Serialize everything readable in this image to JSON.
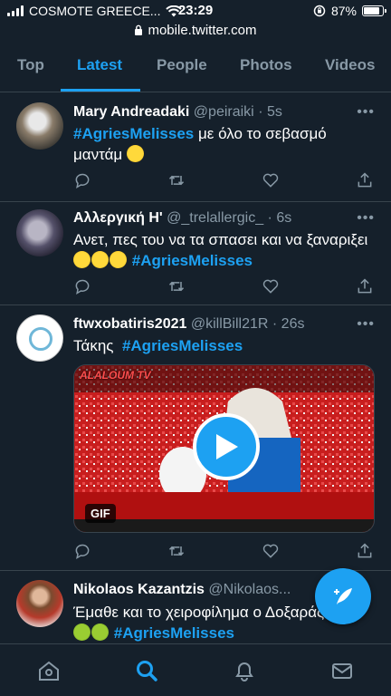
{
  "status_bar": {
    "carrier": "COSMOTE GREECE...",
    "time": "23:29",
    "battery": "87%",
    "battery_level": 0.87
  },
  "browser": {
    "url": "mobile.twitter.com"
  },
  "tabs": [
    {
      "label": "Top",
      "active": false
    },
    {
      "label": "Latest",
      "active": true
    },
    {
      "label": "People",
      "active": false
    },
    {
      "label": "Photos",
      "active": false
    },
    {
      "label": "Videos",
      "active": false
    }
  ],
  "tweets": [
    {
      "name": "Mary Andreadaki",
      "handle": "@peiraiki",
      "time": "5s",
      "hashtag": "#AgriesMelisses",
      "text": "με όλο το σεβασμό",
      "text2": "μαντάμ"
    },
    {
      "name": "Αλλεργική Η'",
      "handle": "@_trelallergic_",
      "time": "6s",
      "text": "Ανετ, πες του να τα σπασει και να ξαναριξει",
      "hashtag": "#AgriesMelisses"
    },
    {
      "name": "ftwxobatiris2021",
      "handle": "@killBill21R",
      "time": "26s",
      "text": "Τάκης",
      "hashtag": "#AgriesMelisses",
      "media": {
        "badge": "GIF",
        "watermark": "ALALOUM TV"
      }
    },
    {
      "name": "Nikolaos Kazantzis",
      "handle": "@Nikolaos...",
      "time": "",
      "text": "Έμαθε και το χειροφίλημα ο Δοξαράς",
      "hashtag": "#AgriesMelisses"
    }
  ],
  "icons": [
    "wifi-icon",
    "lock-icon",
    "reply-icon",
    "retweet-icon",
    "like-icon",
    "share-icon",
    "home-icon",
    "search-icon",
    "bell-icon",
    "mail-icon",
    "compose-icon",
    "play-icon"
  ],
  "colors": {
    "background": "#15202b",
    "accent": "#1da1f2",
    "muted": "#8899a6",
    "border": "#38444d"
  }
}
